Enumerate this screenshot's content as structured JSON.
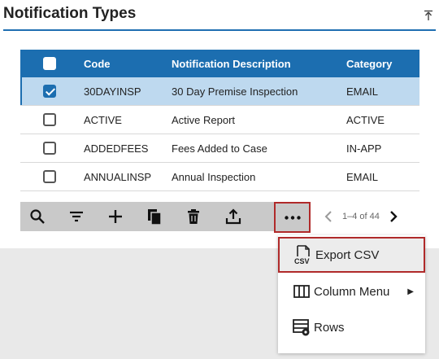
{
  "title": "Notification Types",
  "columns": [
    "Code",
    "Notification Description",
    "Category"
  ],
  "rows": [
    {
      "code": "30DAYINSP",
      "desc": "30 Day Premise Inspection",
      "cat": "EMAIL",
      "checked": true
    },
    {
      "code": "ACTIVE",
      "desc": "Active Report",
      "cat": "ACTIVE",
      "checked": false
    },
    {
      "code": "ADDEDFEES",
      "desc": "Fees Added to Case",
      "cat": "IN-APP",
      "checked": false
    },
    {
      "code": "ANNUALINSP",
      "desc": "Annual Inspection",
      "cat": "EMAIL",
      "checked": false
    }
  ],
  "pager": {
    "range": "1–4 of 44"
  },
  "menu": {
    "export": "Export CSV",
    "export_icon_text": "CSV",
    "column": "Column Menu",
    "rows": "Rows"
  },
  "colors": {
    "header": "#1c6eb0",
    "selected_row": "#bed9ef",
    "highlight_border": "#b02a2a"
  },
  "icons": [
    "search-icon",
    "filter-icon",
    "add-icon",
    "copy-icon",
    "delete-icon",
    "upload-icon",
    "more-icon",
    "chevron-left-icon",
    "chevron-right-icon",
    "csv-icon",
    "column-menu-icon",
    "rows-icon",
    "collapse-icon"
  ]
}
